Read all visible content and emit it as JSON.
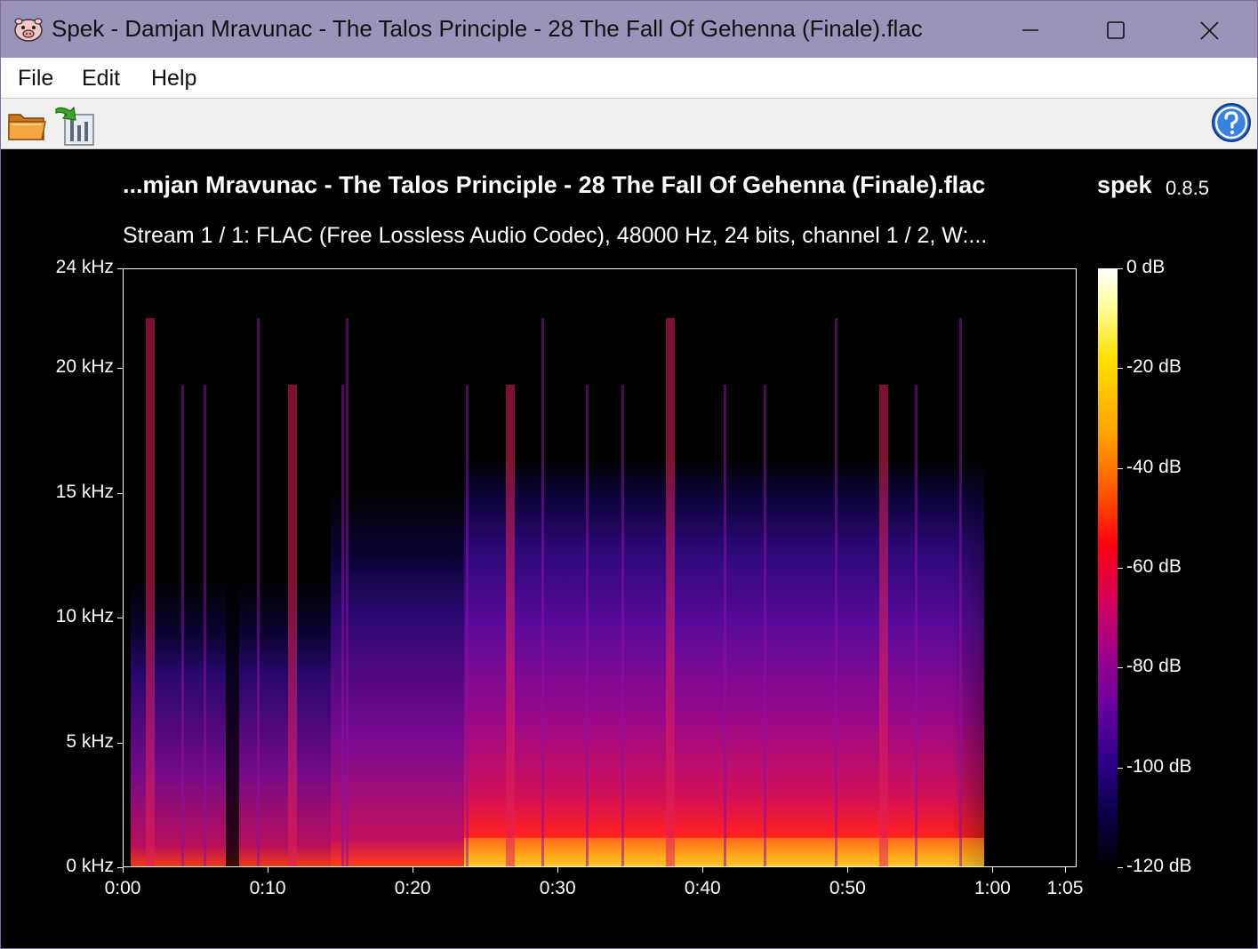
{
  "window": {
    "title": "Spek - Damjan Mravunac - The Talos Principle - 28 The Fall Of Gehenna (Finale).flac"
  },
  "menu": {
    "file": "File",
    "edit": "Edit",
    "help": "Help"
  },
  "header": {
    "file_title": "...mjan Mravunac - The Talos Principle - 28 The Fall Of Gehenna (Finale).flac",
    "app_name": "spek",
    "app_version": "0.8.5",
    "stream_info": "Stream 1 / 1: FLAC (Free Lossless Audio Codec), 48000 Hz, 24 bits, channel 1 / 2, W:..."
  },
  "spectrogram": {
    "freq_ticks": [
      "24 kHz",
      "20 kHz",
      "15 kHz",
      "10 kHz",
      "5 kHz",
      "0 kHz"
    ],
    "freq_values_khz": [
      24,
      20,
      15,
      10,
      5,
      0
    ],
    "time_ticks": [
      "0:00",
      "0:10",
      "0:20",
      "0:30",
      "0:40",
      "0:50",
      "1:00",
      "1:05"
    ],
    "time_values_s": [
      0,
      10,
      20,
      30,
      40,
      50,
      60,
      65
    ],
    "duration_s": 65.8,
    "db_ticks": [
      "0 dB",
      "-20 dB",
      "-40 dB",
      "-60 dB",
      "-80 dB",
      "-100 dB",
      "-120 dB"
    ],
    "db_values": [
      0,
      -20,
      -40,
      -60,
      -80,
      -100,
      -120
    ]
  },
  "icons": {
    "app": "pig-face-icon",
    "open": "folder-icon",
    "save": "save-image-icon",
    "help": "help-icon"
  }
}
